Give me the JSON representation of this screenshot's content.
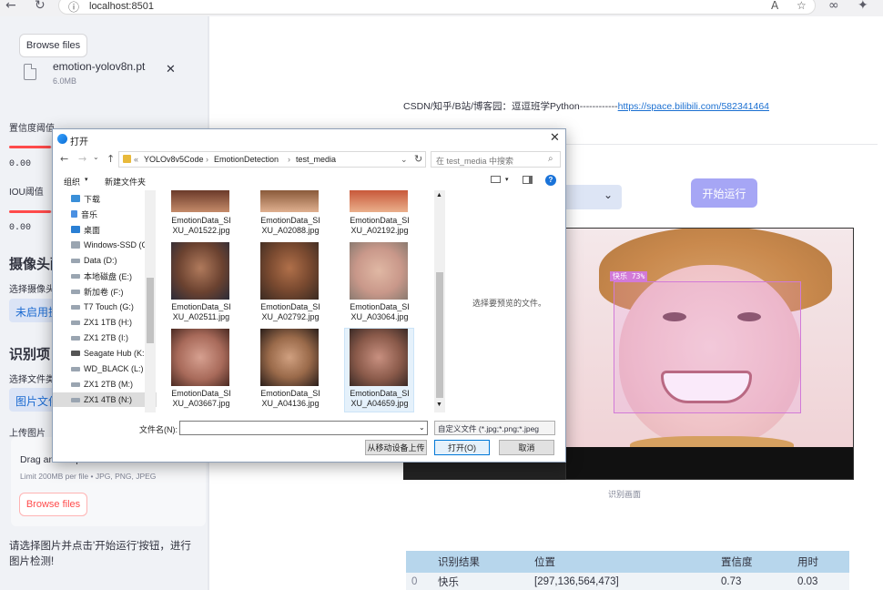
{
  "browser": {
    "url": "localhost:8501"
  },
  "sidebar": {
    "browse_top": "Browse files",
    "model_file": {
      "name": "emotion-yolov8n.pt",
      "size": "6.0MB"
    },
    "conf_label": "置信度阈值",
    "conf_value": "0.00",
    "iou_label": "IOU阈值",
    "iou_value": "0.00",
    "camera_title": "摄像头配",
    "camera_select_label": "选择摄像头",
    "camera_select_value": "未启用摄",
    "project_title": "识别项目",
    "file_type_label": "选择文件类型",
    "file_type_value": "图片文件",
    "upload_label": "上传图片",
    "drag_text": "Drag and drop file here",
    "limit_text": "Limit 200MB per file • JPG, PNG, JPEG",
    "browse_bottom": "Browse files",
    "hint": "请选择图片并点击'开始运行'按钮，进行图片检测!"
  },
  "main": {
    "csdn_text": "CSDN/知乎/B站/博客园：逗逗班学Python------------",
    "csdn_link": "https://space.bilibili.com/582341464",
    "run_button": "开始运行",
    "detect_label": "快乐  73%",
    "caption": "识别画面",
    "table": {
      "headers": [
        "识别结果",
        "位置",
        "置信度",
        "用时"
      ],
      "rows": [
        {
          "index": "0",
          "result": "快乐",
          "position": "[297,136,564,473]",
          "confidence": "0.73",
          "time": "0.03"
        }
      ]
    }
  },
  "dialog": {
    "title": "打开",
    "breadcrumb": [
      "YOLOv8v5Code",
      "EmotionDetection",
      "test_media"
    ],
    "search_placeholder": "在 test_media 中搜索",
    "organize": "组织",
    "new_folder": "新建文件夹",
    "nav": [
      "下载",
      "音乐",
      "桌面",
      "Windows-SSD (C",
      "Data (D:)",
      "本地磁盘 (E:)",
      "新加卷 (F:)",
      "T7 Touch (G:)",
      "ZX1 1TB (H:)",
      "ZX1 2TB (I:)",
      "Seagate Hub (K:",
      "WD_BLACK (L:)",
      "ZX1 2TB (M:)",
      "ZX1 4TB (N:)"
    ],
    "files": [
      [
        "EmotionData_SI",
        "XU_A01522.jpg"
      ],
      [
        "EmotionData_SI",
        "XU_A02088.jpg"
      ],
      [
        "EmotionData_SI",
        "XU_A02192.jpg"
      ],
      [
        "EmotionData_SI",
        "XU_A02511.jpg"
      ],
      [
        "EmotionData_SI",
        "XU_A02792.jpg"
      ],
      [
        "EmotionData_SI",
        "XU_A03064.jpg"
      ],
      [
        "EmotionData_SI",
        "XU_A03667.jpg"
      ],
      [
        "EmotionData_SI",
        "XU_A04136.jpg"
      ],
      [
        "EmotionData_SI",
        "XU_A04659.jpg"
      ]
    ],
    "preview_text": "选择要预览的文件。",
    "filename_label": "文件名(N):",
    "filetype_value": "自定义文件 (*.jpg;*.png;*.jpeg",
    "upload_mobile": "从移动设备上传",
    "open_button": "打开(O)",
    "cancel_button": "取消"
  }
}
